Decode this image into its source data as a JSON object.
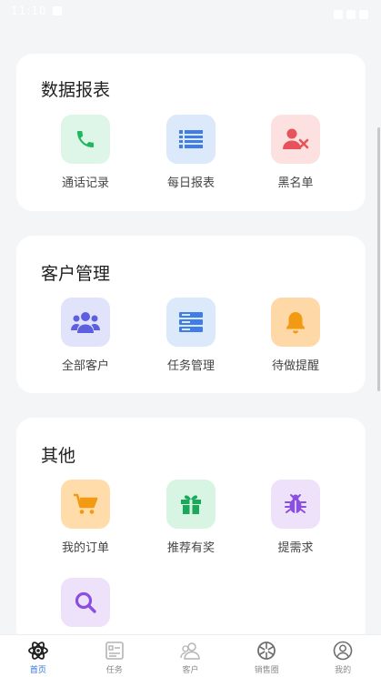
{
  "status_bar": {
    "time": "11:10"
  },
  "sections": {
    "reports": {
      "title": "数据报表",
      "items": [
        {
          "label": "通话记录",
          "icon": "phone-icon",
          "bg": "#ddf6e7",
          "color": "#1fb760"
        },
        {
          "label": "每日报表",
          "icon": "list-icon",
          "bg": "#dbe9fb",
          "color": "#3f7de8"
        },
        {
          "label": "黑名单",
          "icon": "block-user-icon",
          "bg": "#fde0e0",
          "color": "#e8525a"
        }
      ]
    },
    "customers": {
      "title": "客户管理",
      "items": [
        {
          "label": "全部客户",
          "icon": "users-icon",
          "bg": "#e1e3fb",
          "color": "#5b5fe0"
        },
        {
          "label": "任务管理",
          "icon": "server-icon",
          "bg": "#dbe9fb",
          "color": "#3f7de8"
        },
        {
          "label": "待做提醒",
          "icon": "bell-icon",
          "bg": "#ffd8a8",
          "color": "#f29a12"
        }
      ]
    },
    "other": {
      "title": "其他",
      "items": [
        {
          "label": "我的订单",
          "icon": "cart-icon",
          "bg": "#ffdcaa",
          "color": "#f29a12"
        },
        {
          "label": "推荐有奖",
          "icon": "gift-icon",
          "bg": "#d8f5e3",
          "color": "#1aa85a"
        },
        {
          "label": "提需求",
          "icon": "bug-icon",
          "bg": "#eee2fb",
          "color": "#8b4fe0"
        },
        {
          "label": "",
          "icon": "search-icon",
          "bg": "#eee2fb",
          "color": "#8b4fe0"
        }
      ]
    }
  },
  "tabbar": {
    "tabs": [
      {
        "label": "首页",
        "icon": "atom-icon",
        "active": true
      },
      {
        "label": "任务",
        "icon": "task-card-icon",
        "active": false
      },
      {
        "label": "客户",
        "icon": "contacts-icon",
        "active": false
      },
      {
        "label": "销售圈",
        "icon": "aperture-icon",
        "active": false
      },
      {
        "label": "我的",
        "icon": "profile-icon",
        "active": false
      }
    ],
    "active_color": "#2f6fe0",
    "inactive_color": "#8a8a8a"
  }
}
